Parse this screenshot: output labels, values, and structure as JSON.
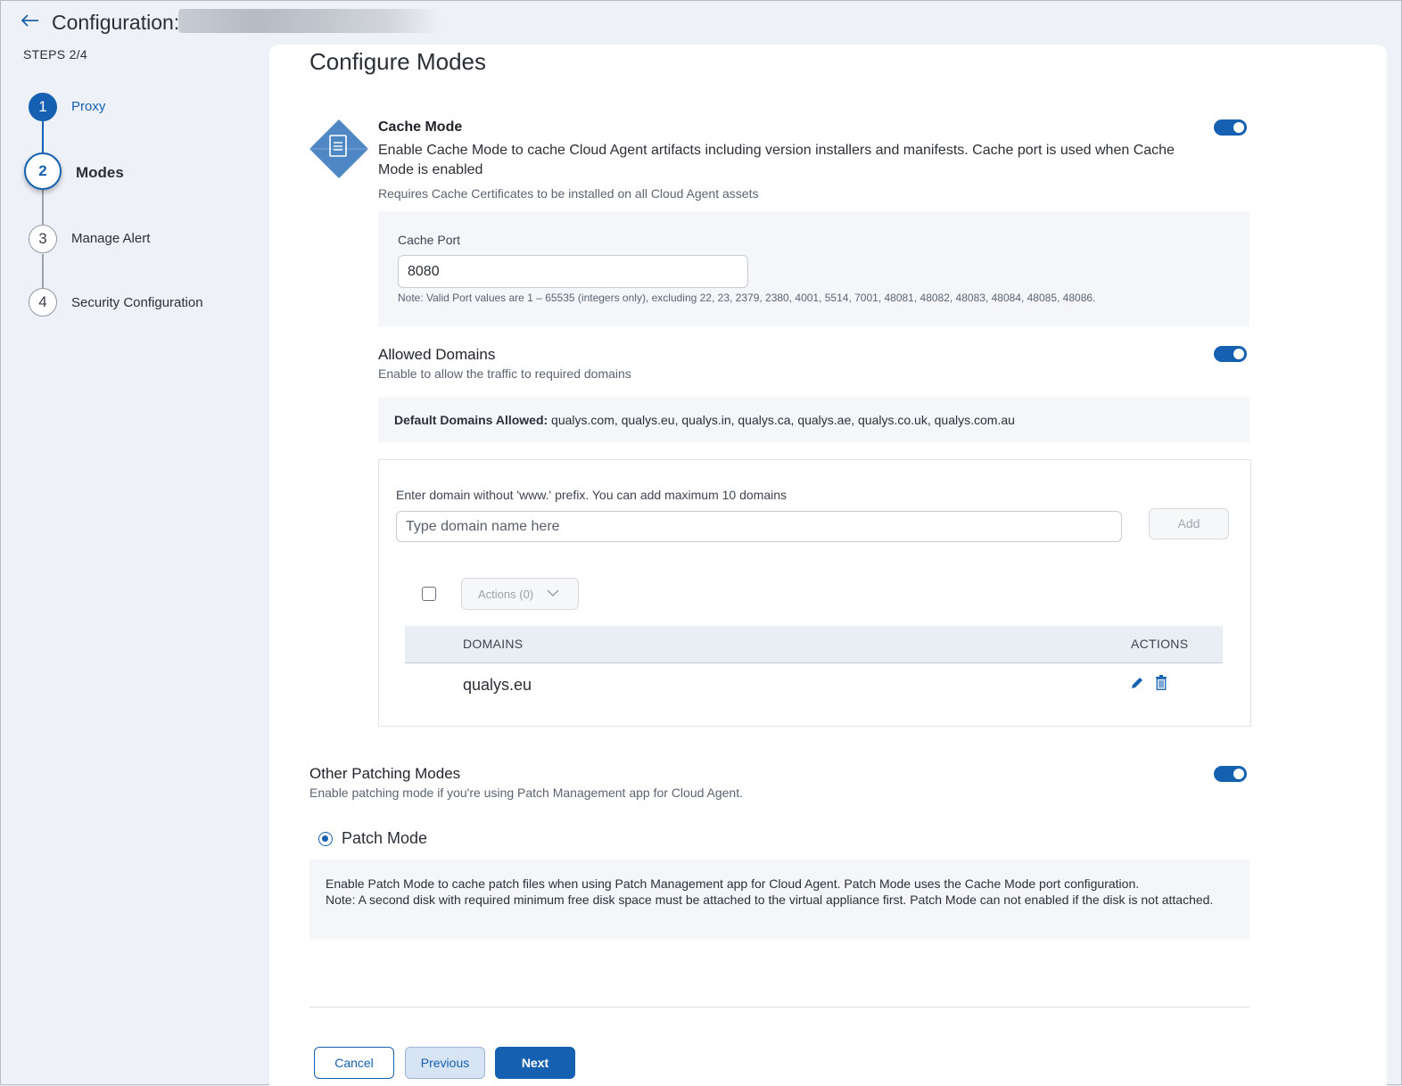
{
  "header": {
    "back_icon": "arrow-left-icon",
    "title": "Configuration:"
  },
  "sidebar": {
    "steps_label": "STEPS 2/4",
    "steps": [
      {
        "number": "1",
        "label": "Proxy",
        "state": "completed"
      },
      {
        "number": "2",
        "label": "Modes",
        "state": "active"
      },
      {
        "number": "3",
        "label": "Manage Alert",
        "state": "pending"
      },
      {
        "number": "4",
        "label": "Security Configuration",
        "state": "pending"
      }
    ]
  },
  "main": {
    "title": "Configure Modes",
    "cache_mode": {
      "icon": "document-diamond-icon",
      "title": "Cache Mode",
      "description": "Enable Cache Mode to cache Cloud Agent artifacts including version installers and manifests. Cache port is used when Cache Mode is enabled",
      "requirement": "Requires Cache Certificates to be installed on all Cloud Agent assets",
      "enabled": true,
      "port_label": "Cache Port",
      "port_value": "8080",
      "port_note": "Note: Valid Port values are 1 – 65535 (integers only), excluding 22, 23, 2379, 2380, 4001, 5514, 7001, 48081, 48082, 48083, 48084, 48085, 48086."
    },
    "allowed_domains": {
      "title": "Allowed Domains",
      "description": "Enable to allow the traffic to required domains",
      "enabled": true,
      "default_label": "Default Domains Allowed:",
      "default_list": " qualys.com, qualys.eu, qualys.in, qualys.ca, qualys.ae, qualys.co.uk, qualys.com.au",
      "input_label": "Enter domain without 'www.' prefix. You can add maximum 10 domains",
      "input_placeholder": "Type domain name here",
      "add_button": "Add",
      "actions_dropdown": "Actions (0)",
      "table": {
        "columns": [
          "DOMAINS",
          "ACTIONS"
        ],
        "rows": [
          {
            "domain": "qualys.eu",
            "edit_icon": "pencil-icon",
            "delete_icon": "trash-icon"
          }
        ]
      }
    },
    "patching": {
      "title": "Other Patching Modes",
      "description": "Enable patching mode if you're using Patch Management app for Cloud Agent.",
      "enabled": true,
      "patch_mode_label": "Patch Mode",
      "patch_mode_selected": true,
      "info_line1": "Enable Patch Mode to cache patch files when using Patch Management app for Cloud Agent. Patch Mode uses the Cache Mode port configuration.",
      "info_line2": "Note: A second disk with required minimum free disk space must be attached to the virtual appliance first. Patch Mode can not enabled if the disk is not attached."
    },
    "footer": {
      "cancel": "Cancel",
      "previous": "Previous",
      "next": "Next"
    }
  },
  "colors": {
    "accent": "#1560b0",
    "page_bg": "#eef2f8",
    "panel_bg": "#f4f6f9"
  }
}
